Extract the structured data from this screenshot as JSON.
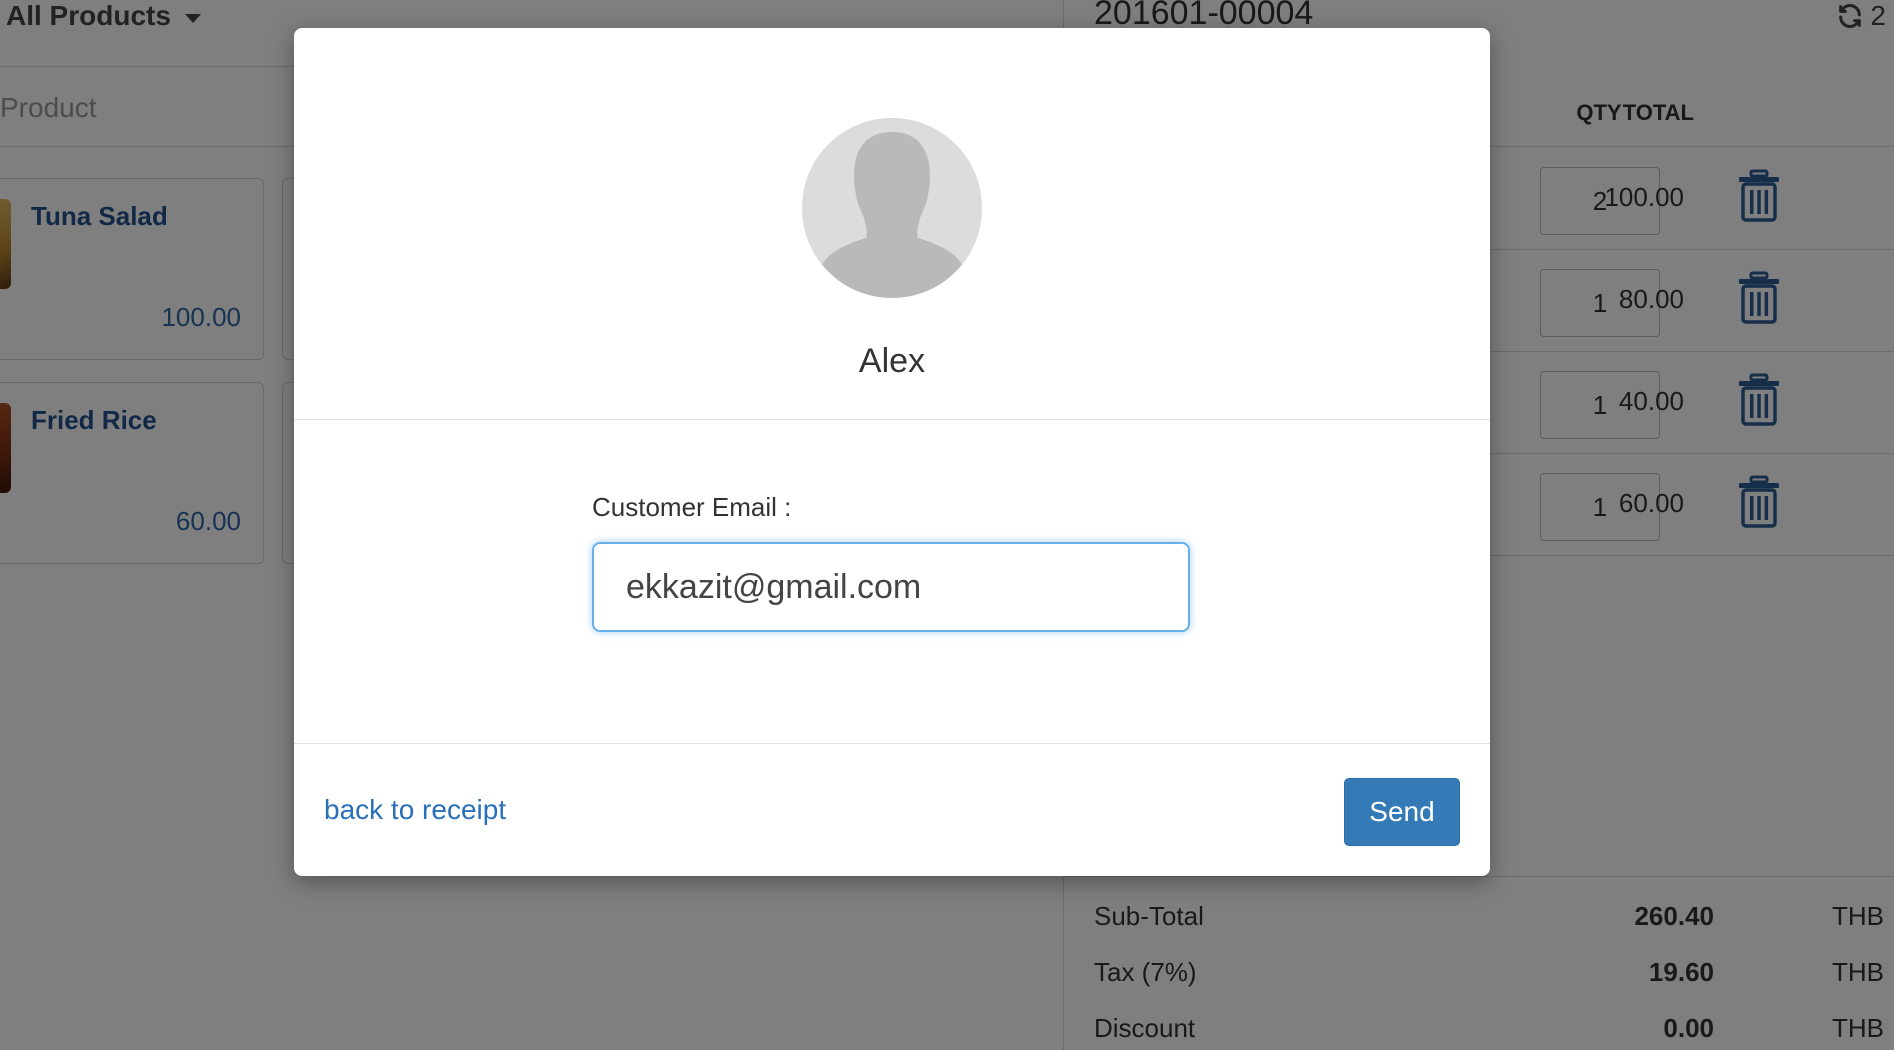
{
  "catalog": {
    "filter_label": "All Products",
    "search_placeholder": "Product",
    "products": [
      {
        "name": "Tuna Salad",
        "price": "100.00"
      },
      {
        "name": "Fried Rice",
        "price": "60.00"
      }
    ]
  },
  "order": {
    "id": "201601-00004",
    "sync_count": "2",
    "columns": {
      "qty": "QTY",
      "total": "TOTAL"
    },
    "lines": [
      {
        "qty": "2",
        "total": "100.00"
      },
      {
        "qty": "1",
        "total": "80.00"
      },
      {
        "qty": "1",
        "total": "40.00"
      },
      {
        "qty": "1",
        "total": "60.00"
      }
    ],
    "totals": [
      {
        "label": "Sub-Total",
        "value": "260.40",
        "currency": "THB"
      },
      {
        "label": "Tax (7%)",
        "value": "19.60",
        "currency": "THB"
      },
      {
        "label": "Discount",
        "value": "0.00",
        "currency": "THB"
      }
    ]
  },
  "modal": {
    "customer_name": "Alex",
    "email_label": "Customer Email :",
    "email_value": "ekkazit@gmail.com",
    "back_link": "back to receipt",
    "send_label": "Send"
  },
  "colors": {
    "accent": "#337ab7",
    "link": "#2a70b8",
    "product_name": "#23528c",
    "trash_icon": "#2c5d94",
    "input_focus": "#66afe9"
  }
}
